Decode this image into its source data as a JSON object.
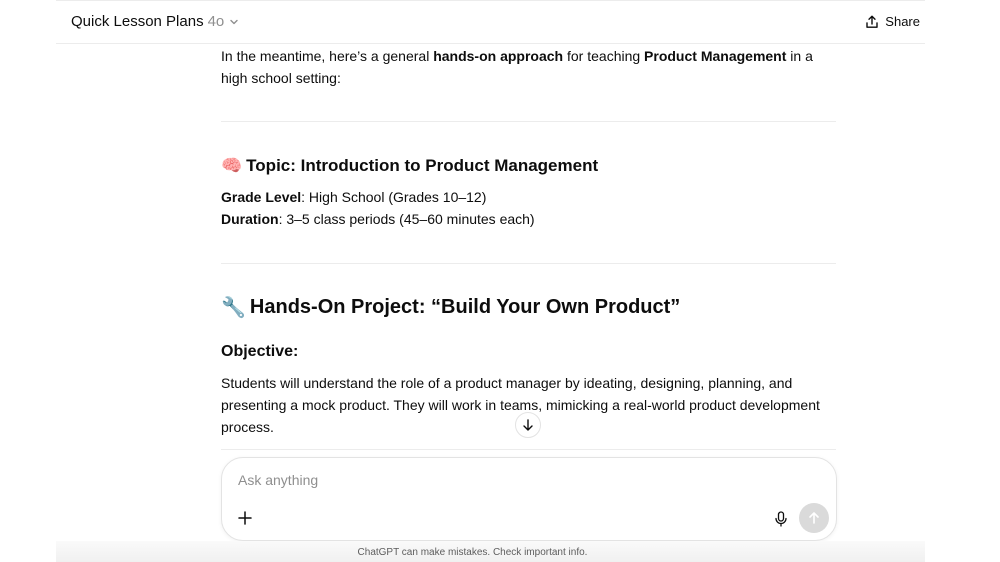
{
  "header": {
    "title": "Quick Lesson Plans",
    "model": "4o",
    "share_label": "Share"
  },
  "content": {
    "intro": {
      "t1": "In the meantime, here’s a general ",
      "b1": "hands-on approach",
      "t2": " for teaching ",
      "b2": "Product Management",
      "t3": " in a high school setting:"
    },
    "topic_heading": {
      "emoji": "🧠",
      "text": "Topic: Introduction to Product Management"
    },
    "grade": {
      "label": "Grade Level",
      "value": ": High School (Grades 10–12)"
    },
    "duration": {
      "label": "Duration",
      "value": ": 3–5 class periods (45–60 minutes each)"
    },
    "project_heading": {
      "emoji": "🔧",
      "text": "Hands-On Project: “Build Your Own Product”"
    },
    "objective_heading": "Objective:",
    "objective_text": "Students will understand the role of a product manager by ideating, designing, planning, and presenting a mock product. They will work in teams, mimicking a real-world product development process."
  },
  "composer": {
    "placeholder": "Ask anything",
    "value": ""
  },
  "footer": {
    "disclaimer": "ChatGPT can make mistakes. Check important info."
  }
}
